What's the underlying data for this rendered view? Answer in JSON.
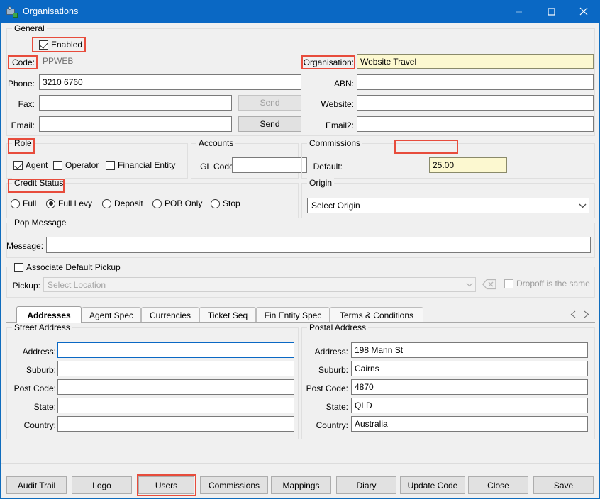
{
  "window": {
    "title": "Organisations",
    "icon": "organisation-icon",
    "accent_color": "#0a68c4",
    "controls": {
      "minimize": "minimize",
      "maximize": "maximize",
      "close": "close"
    }
  },
  "general": {
    "legend": "General",
    "enabled": {
      "label": "Enabled",
      "checked": true
    },
    "code": {
      "label": "Code:",
      "value": "PPWEB",
      "readonly": true
    },
    "organisation": {
      "label": "Organisation:",
      "value": "Website Travel"
    },
    "phone": {
      "label": "Phone:",
      "value": "3210 6760"
    },
    "abn": {
      "label": "ABN:",
      "value": ""
    },
    "fax": {
      "label": "Fax:",
      "value": "",
      "send_label": "Send",
      "send_disabled": true
    },
    "website": {
      "label": "Website:",
      "value": ""
    },
    "email": {
      "label": "Email:",
      "value": "",
      "send_label": "Send",
      "send_disabled": false
    },
    "email2": {
      "label": "Email2:",
      "value": ""
    }
  },
  "role": {
    "legend": "Role",
    "options": [
      {
        "label": "Agent",
        "checked": true
      },
      {
        "label": "Operator",
        "checked": false
      },
      {
        "label": "Financial Entity",
        "checked": false
      }
    ]
  },
  "accounts": {
    "legend": "Accounts",
    "gl_code": {
      "label": "GL Code:",
      "value": ""
    }
  },
  "commissions": {
    "legend": "Commissions",
    "default": {
      "label": "Default:",
      "value": "25.00"
    }
  },
  "credit_status": {
    "legend": "Credit Status",
    "options": [
      {
        "label": "Full",
        "selected": false
      },
      {
        "label": "Full Levy",
        "selected": true
      },
      {
        "label": "Deposit",
        "selected": false
      },
      {
        "label": "POB Only",
        "selected": false
      },
      {
        "label": "Stop",
        "selected": false
      }
    ]
  },
  "origin": {
    "legend": "Origin",
    "value": "Select Origin",
    "icon": "chevron-down-icon"
  },
  "pop_message": {
    "legend": "Pop Message",
    "message": {
      "label": "Message:",
      "value": ""
    }
  },
  "pickup": {
    "associate_label": "Associate Default Pickup",
    "associate_checked": false,
    "label": "Pickup:",
    "placeholder": "Select Location",
    "clear_icon": "clear-backspace-icon",
    "dropoff_label": "Dropoff is the same",
    "dropoff_checked": false
  },
  "tabs": {
    "items": [
      {
        "label": "Addresses",
        "active": true
      },
      {
        "label": "Agent Spec",
        "active": false
      },
      {
        "label": "Currencies",
        "active": false
      },
      {
        "label": "Ticket Seq",
        "active": false
      },
      {
        "label": "Fin Entity Spec",
        "active": false
      },
      {
        "label": "Terms & Conditions",
        "active": false
      }
    ],
    "nav_prev_icon": "chevron-left-icon",
    "nav_next_icon": "chevron-right-icon"
  },
  "street_address": {
    "legend": "Street Address",
    "fields": [
      {
        "label": "Address:",
        "value": "",
        "focused": true
      },
      {
        "label": "Suburb:",
        "value": ""
      },
      {
        "label": "Post Code:",
        "value": ""
      },
      {
        "label": "State:",
        "value": ""
      },
      {
        "label": "Country:",
        "value": ""
      }
    ]
  },
  "postal_address": {
    "legend": "Postal Address",
    "fields": [
      {
        "label": "Address:",
        "value": "198 Mann St"
      },
      {
        "label": "Suburb:",
        "value": "Cairns"
      },
      {
        "label": "Post Code:",
        "value": "4870"
      },
      {
        "label": "State:",
        "value": "QLD"
      },
      {
        "label": "Country:",
        "value": "Australia"
      }
    ]
  },
  "footer": {
    "buttons": [
      {
        "label": "Audit Trail"
      },
      {
        "label": "Logo"
      },
      {
        "label": "Users"
      },
      {
        "label": "Commissions"
      },
      {
        "label": "Mappings"
      },
      {
        "label": "Diary"
      },
      {
        "label": "Update Code"
      },
      {
        "label": "Close"
      },
      {
        "label": "Save"
      }
    ]
  },
  "annotations": {
    "color": "#e74c3c",
    "targets": [
      "Enabled",
      "Code:",
      "Organisation:",
      "Role",
      "Commissions",
      "Credit Status",
      "Users"
    ]
  }
}
